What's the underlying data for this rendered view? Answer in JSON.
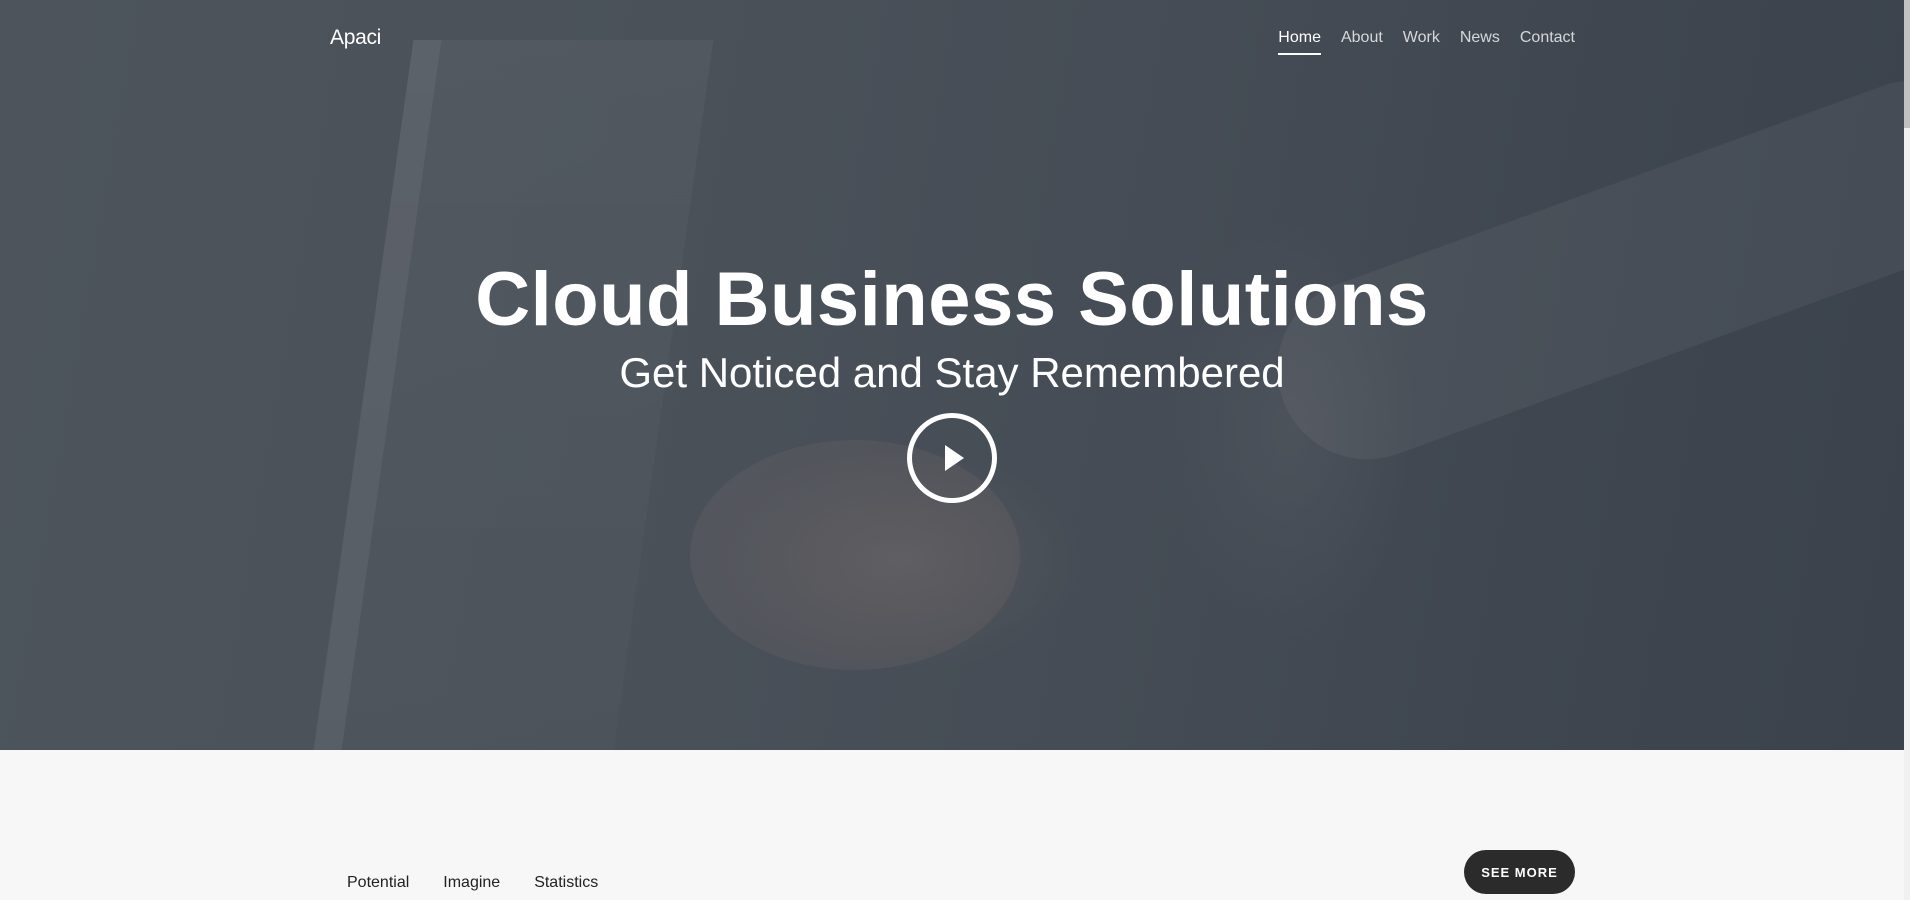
{
  "header": {
    "brand": "Apaci",
    "nav": [
      {
        "label": "Home",
        "active": true
      },
      {
        "label": "About",
        "active": false
      },
      {
        "label": "Work",
        "active": false
      },
      {
        "label": "News",
        "active": false
      },
      {
        "label": "Contact",
        "active": false
      }
    ]
  },
  "hero": {
    "title": "Cloud Business Solutions",
    "subtitle": "Get Noticed and Stay Remembered",
    "play_icon": "play-icon"
  },
  "section": {
    "tabs": [
      "Potential",
      "Imagine",
      "Statistics"
    ],
    "see_more_label": "SEE MORE"
  },
  "colors": {
    "hero_overlay": "#474e57",
    "button_bg": "#2b2b2b",
    "page_bg": "#f7f7f7"
  }
}
